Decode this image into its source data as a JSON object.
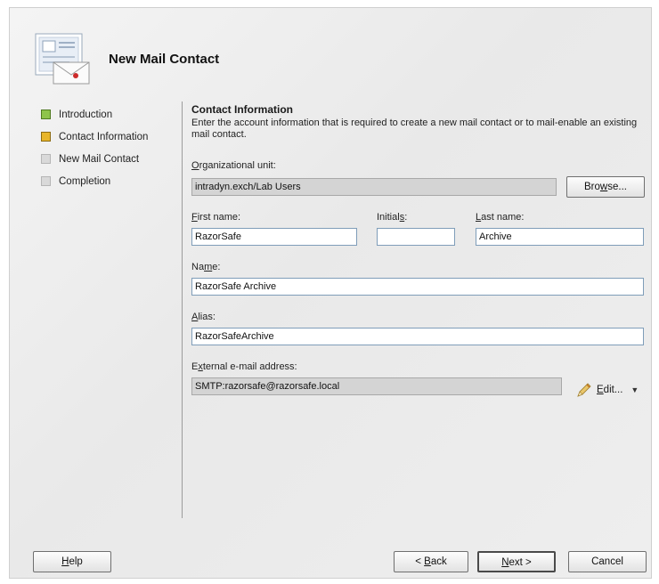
{
  "window": {
    "title": "New Mail Contact"
  },
  "steps": [
    {
      "label": "Introduction",
      "state": "done"
    },
    {
      "label": "Contact Information",
      "state": "current"
    },
    {
      "label": "New Mail Contact",
      "state": "pending"
    },
    {
      "label": "Completion",
      "state": "pending"
    }
  ],
  "page": {
    "heading": "Contact Information",
    "description": "Enter the account information that is required to create a new mail contact or to mail-enable an existing mail contact."
  },
  "form": {
    "ou": {
      "label_accel": "O",
      "label_rest": "rganizational unit:",
      "value": "intradyn.exch/Lab Users"
    },
    "browse": {
      "label_pre": "Bro",
      "label_accel": "w",
      "label_post": "se..."
    },
    "first": {
      "label_accel": "F",
      "label_rest": "irst name:",
      "value": "RazorSafe"
    },
    "initials": {
      "label_pre": "Initial",
      "label_accel": "s",
      "label_post": ":",
      "value": ""
    },
    "last": {
      "label_accel": "L",
      "label_rest": "ast name:",
      "value": "Archive"
    },
    "name": {
      "label_pre": "Na",
      "label_accel": "m",
      "label_post": "e:",
      "value": "RazorSafe Archive"
    },
    "alias": {
      "label_accel": "A",
      "label_rest": "lias:",
      "value": "RazorSafeArchive"
    },
    "email": {
      "label_pre": "E",
      "label_accel": "x",
      "label_post": "ternal e-mail address:",
      "value": "SMTP:razorsafe@razorsafe.local"
    },
    "edit": {
      "label_accel": "E",
      "label_rest": "dit...",
      "caret": "▼"
    }
  },
  "buttons": {
    "help": {
      "accel": "H",
      "rest": "elp"
    },
    "back": {
      "pre": "< ",
      "accel": "B",
      "rest": "ack"
    },
    "next": {
      "accel": "N",
      "rest": "ext >"
    },
    "cancel": "Cancel"
  },
  "colors": {
    "step_done": "#8ec44a",
    "step_current": "#e8b52a",
    "step_pending": "#d9d9d9"
  }
}
